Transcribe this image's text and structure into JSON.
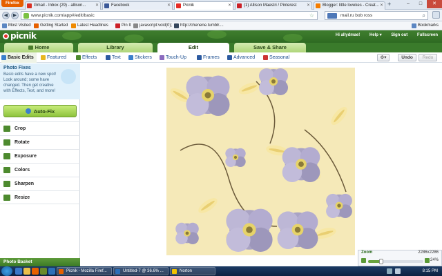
{
  "browser": {
    "menu_button": "Firefox",
    "tabs": [
      {
        "label": "Gmail - Inbox (29) - allison...",
        "color": "#d93025"
      },
      {
        "label": "Facebook",
        "color": "#3b5998"
      },
      {
        "label": "Picnik",
        "color": "#e52d27"
      },
      {
        "label": "(1) Allison Maestri / Pinterest",
        "color": "#cb2027"
      },
      {
        "label": "Blogger: little lovekes - Creat...",
        "color": "#f57d00"
      }
    ],
    "new_tab": "+",
    "window_controls": {
      "minimize": "–",
      "maximize": "□",
      "close": "✕"
    },
    "back": "◀",
    "forward": "▶",
    "url": "www.picnik.com/app#/edit/basic",
    "search_text": "mail.ru bob ross",
    "bookmarks_label": "Bookmarks",
    "bookmarks": [
      {
        "label": "Most Visited",
        "color": "#5b86c2"
      },
      {
        "label": "Getting Started",
        "color": "#e66000"
      },
      {
        "label": "Latest Headlines",
        "color": "#ef8a00"
      },
      {
        "label": "Pin It",
        "color": "#cb2027"
      },
      {
        "label": "javascript:void(0);",
        "color": "#888888"
      },
      {
        "label": "http://chenene.tumblr....",
        "color": "#35465c"
      }
    ]
  },
  "picnik": {
    "logo": "picnik",
    "user_links": [
      "Hi allydmae!",
      "Help ▾",
      "Sign out",
      "Fullscreen"
    ],
    "main_tabs": [
      {
        "label": "Home"
      },
      {
        "label": "Library"
      },
      {
        "label": "Edit"
      },
      {
        "label": "Save & Share"
      }
    ],
    "sub_tabs": [
      {
        "label": "Basic Edits",
        "color": "#3a7fcc"
      },
      {
        "label": "Featured",
        "color": "#e8b720"
      },
      {
        "label": "Effects",
        "color": "#4d8a2e"
      },
      {
        "label": "Text",
        "color": "#2c5aa0"
      },
      {
        "label": "Stickers",
        "color": "#3a7fcc"
      },
      {
        "label": "Touch-Up",
        "color": "#8a6bbf"
      },
      {
        "label": "Frames",
        "color": "#2c5aa0"
      },
      {
        "label": "Advanced",
        "color": "#2c5aa0"
      },
      {
        "label": "Seasonal",
        "color": "#cc3333"
      }
    ],
    "gear_label": "⚙▾",
    "undo": "Undo",
    "redo": "Redo",
    "tip": {
      "title": "Photo Fixes",
      "body": "Basic edits have a new spot! Look around; some have changed. Then get creative with Effects, Text, and more!"
    },
    "autofix": "Auto-Fix",
    "tools": [
      "Crop",
      "Rotate",
      "Exposure",
      "Colors",
      "Sharpen",
      "Resize"
    ],
    "photo_basket": "Photo Basket",
    "zoom": {
      "label": "Zoom",
      "dimensions": "2286x2286",
      "percent": "24%",
      "level": 0.24
    }
  },
  "taskbar": {
    "tasks": [
      {
        "label": "Picnik - Mozilla Firef...",
        "color": "#e66000"
      },
      {
        "label": "Untitled-7 @ 36.6% ...",
        "color": "#2c6fb8"
      },
      {
        "label": "Norton",
        "color": "#f2c200"
      }
    ],
    "time": "8:15 PM"
  }
}
